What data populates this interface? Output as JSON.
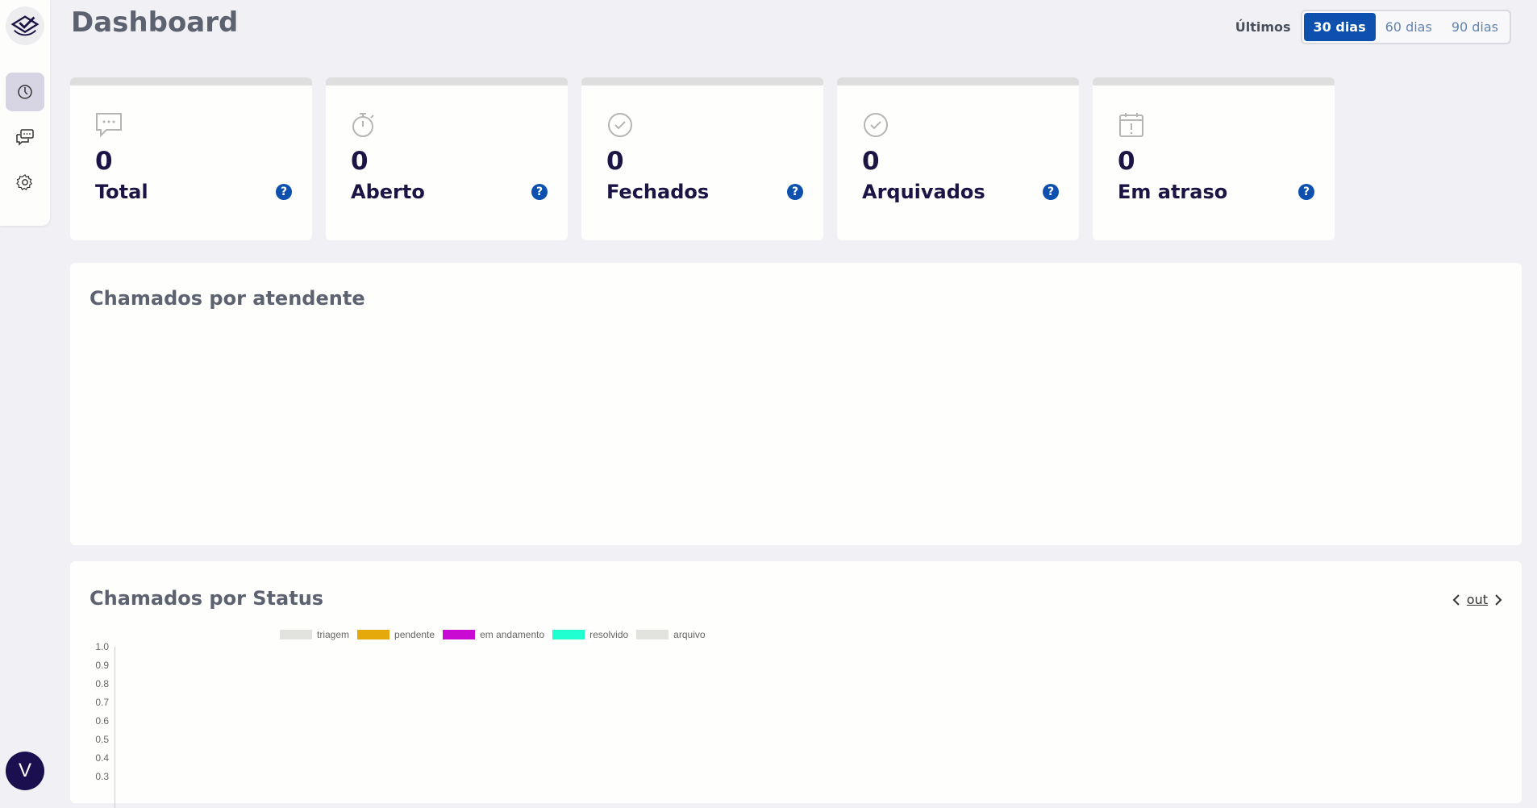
{
  "header": {
    "title": "Dashboard",
    "period_label": "Últimos",
    "periods": [
      "30 dias",
      "60 dias",
      "90 dias"
    ],
    "selected_period": "30 dias"
  },
  "sidebar": {
    "items": [
      {
        "icon": "dashboard-icon",
        "active": true
      },
      {
        "icon": "chat-icon",
        "active": false
      },
      {
        "icon": "gear-icon",
        "active": false
      }
    ],
    "avatar_initial": "V"
  },
  "cards": [
    {
      "icon": "chat-bubble-icon",
      "value": "0",
      "label": "Total"
    },
    {
      "icon": "timer-icon",
      "value": "0",
      "label": "Aberto"
    },
    {
      "icon": "check-circle-icon",
      "value": "0",
      "label": "Fechados"
    },
    {
      "icon": "check-circle-icon",
      "value": "0",
      "label": "Arquivados"
    },
    {
      "icon": "calendar-alert-icon",
      "value": "0",
      "label": "Em atraso"
    }
  ],
  "help_glyph": "?",
  "panels": {
    "by_agent_title": "Chamados por atendente",
    "by_status_title": "Chamados por Status",
    "month": "out"
  },
  "colors": {
    "accent": "#0d50ad",
    "navy": "#1c1445",
    "triagem": "#e2e2df",
    "pendente": "#e6a90c",
    "em_andamento": "#c90ad3",
    "resolvido": "#1fffcf",
    "arquivo": "#e2e2df"
  },
  "chart_data": {
    "type": "bar",
    "title": "Chamados por Status",
    "series": [
      {
        "name": "triagem",
        "values": []
      },
      {
        "name": "pendente",
        "values": []
      },
      {
        "name": "em andamento",
        "values": []
      },
      {
        "name": "resolvido",
        "values": []
      },
      {
        "name": "arquivo",
        "values": []
      }
    ],
    "yticks": [
      "1.0",
      "0.9",
      "0.8",
      "0.7",
      "0.6",
      "0.5",
      "0.4",
      "0.3"
    ],
    "ylim": [
      0,
      1.0
    ],
    "legend": "top"
  }
}
